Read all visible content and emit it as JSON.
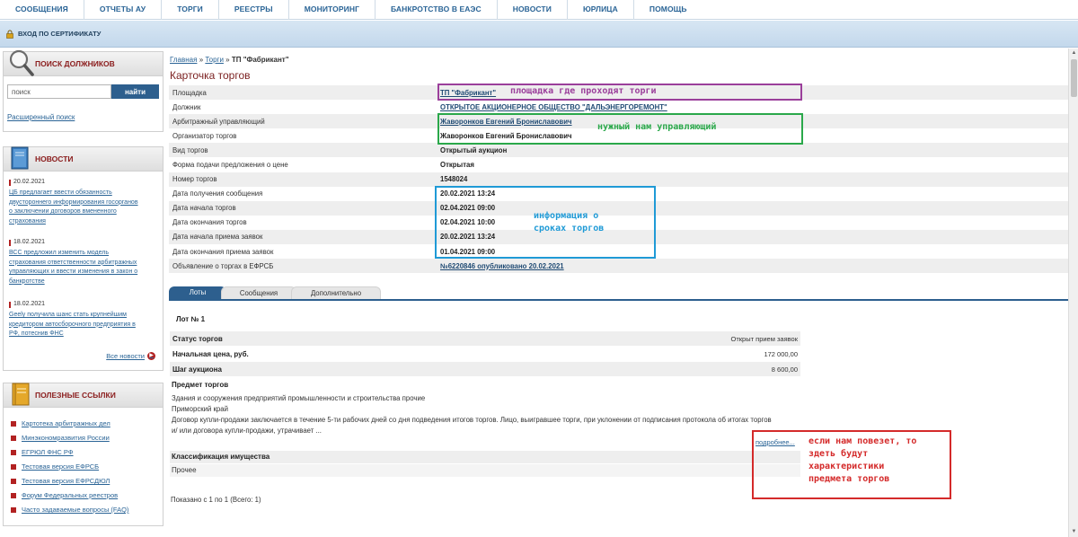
{
  "topnav": {
    "items": [
      "СООБЩЕНИЯ",
      "ОТЧЕТЫ АУ",
      "ТОРГИ",
      "РЕЕСТРЫ",
      "МОНИТОРИНГ",
      "БАНКРОТСТВО В ЕАЭС",
      "НОВОСТИ",
      "ЮРЛИЦА",
      "ПОМОЩЬ"
    ]
  },
  "certbar": {
    "label": "ВХОД ПО СЕРТИФИКАТУ"
  },
  "sidebar": {
    "search": {
      "title": "ПОИСК ДОЛЖНИКОВ",
      "input_value": "поиск",
      "button": "найти",
      "advanced": "Расширенный поиск"
    },
    "news": {
      "title": "НОВОСТИ",
      "items": [
        {
          "date": "20.02.2021",
          "text": [
            "ЦБ предлагает ввести обязанность",
            "двустороннего информирования госорганов",
            "о заключении договоров вмененного",
            "страхования"
          ]
        },
        {
          "date": "18.02.2021",
          "text": [
            "ВСС предложил изменить модель",
            "страхования ответственности арбитражных",
            "управляющих и ввести изменения в закон о",
            "банкротстве"
          ]
        },
        {
          "date": "18.02.2021",
          "text": [
            "Geely получила шанс стать крупнейшим",
            "кредитором автосборочного предприятия в",
            "РФ, потеснив ФНС"
          ]
        }
      ],
      "all_news": "Все новости"
    },
    "links": {
      "title": "ПОЛЕЗНЫЕ ССЫЛКИ",
      "items": [
        "Картотека арбитражных дел",
        "Минэкономразвития России",
        "ЕГРЮЛ ФНС РФ",
        "Тестовая версия ЕФРСБ",
        "Тестовая версия ЕФРСДЮЛ",
        "Форум Федеральных реестров",
        "Часто задаваемые вопросы (FAQ)"
      ]
    }
  },
  "breadcrumb": {
    "home": "Главная",
    "sep": "»",
    "trades": "Торги",
    "current": "ТП \"Фабрикант\""
  },
  "page_title": "Карточка торгов",
  "info_rows": [
    {
      "key": "Площадка",
      "value": "ТП \"Фабрикант\"",
      "link": true
    },
    {
      "key": "Должник",
      "value": "ОТКРЫТОЕ АКЦИОНЕРНОЕ ОБЩЕСТВО \"ДАЛЬЭНЕРГОРЕМОНТ\"",
      "link": true
    },
    {
      "key": "Арбитражный управляющий",
      "value": "Жаворонков Евгений Брониславович",
      "link": true
    },
    {
      "key": "Организатор торгов",
      "value": "Жаворонков Евгений Брониславович",
      "link": false
    },
    {
      "key": "Вид торгов",
      "value": "Открытый аукцион",
      "link": false
    },
    {
      "key": "Форма подачи предложения о цене",
      "value": "Открытая",
      "link": false
    },
    {
      "key": "Номер торгов",
      "value": "1548024",
      "link": false
    },
    {
      "key": "Дата получения сообщения",
      "value": "20.02.2021 13:24",
      "link": false
    },
    {
      "key": "Дата начала торгов",
      "value": "02.04.2021 09:00",
      "link": false
    },
    {
      "key": "Дата окончания торгов",
      "value": "02.04.2021 10:00",
      "link": false
    },
    {
      "key": "Дата начала приема заявок",
      "value": "20.02.2021 13:24",
      "link": false
    },
    {
      "key": "Дата окончания приема заявок",
      "value": "01.04.2021 09:00",
      "link": false
    },
    {
      "key": "Объявление о торгах в ЕФРСБ",
      "value": "№6220846 опубликовано 20.02.2021",
      "link": true
    }
  ],
  "tabs": [
    "Лоты",
    "Сообщения",
    "Дополнительно"
  ],
  "lot": {
    "title": "Лот № 1",
    "rows": [
      {
        "key": "Статус торгов",
        "value": "Открыт прием заявок"
      },
      {
        "key": "Начальная цена, руб.",
        "value": "172 000,00"
      },
      {
        "key": "Шаг аукциона",
        "value": "8 600,00"
      }
    ],
    "subject_title": "Предмет торгов",
    "subject_lines": [
      "Здания и сооружения предприятий промышленности и строительства прочие",
      "Приморский край",
      "Договор купли-продажи заключается в течение 5-ти рабочих дней со дня подведения итогов торгов. Лицо, выигравшее торги, при уклонении от подписания протокола об итогах торгов",
      "и/ или договора купли-продажи, утрачивает ..."
    ],
    "more": "подробнее...",
    "class_title": "Классификация имущества",
    "class_value": "Прочее"
  },
  "pager": "Показано с 1 по 1 (Всего: 1)",
  "annotations": {
    "platform": {
      "text": [
        "площадка где проходят торги"
      ],
      "color": "#9b3f9b"
    },
    "manager": {
      "text": [
        "нужный нам управляющий"
      ],
      "color": "#2aa84a"
    },
    "dates": {
      "text": [
        "информация о",
        "сроках торгов"
      ],
      "color": "#1f9ad6"
    },
    "subject": {
      "text": [
        "если нам повезет, то",
        "здеть будут",
        "характеристики",
        "предмета торгов"
      ],
      "color": "#d42a2a"
    }
  }
}
